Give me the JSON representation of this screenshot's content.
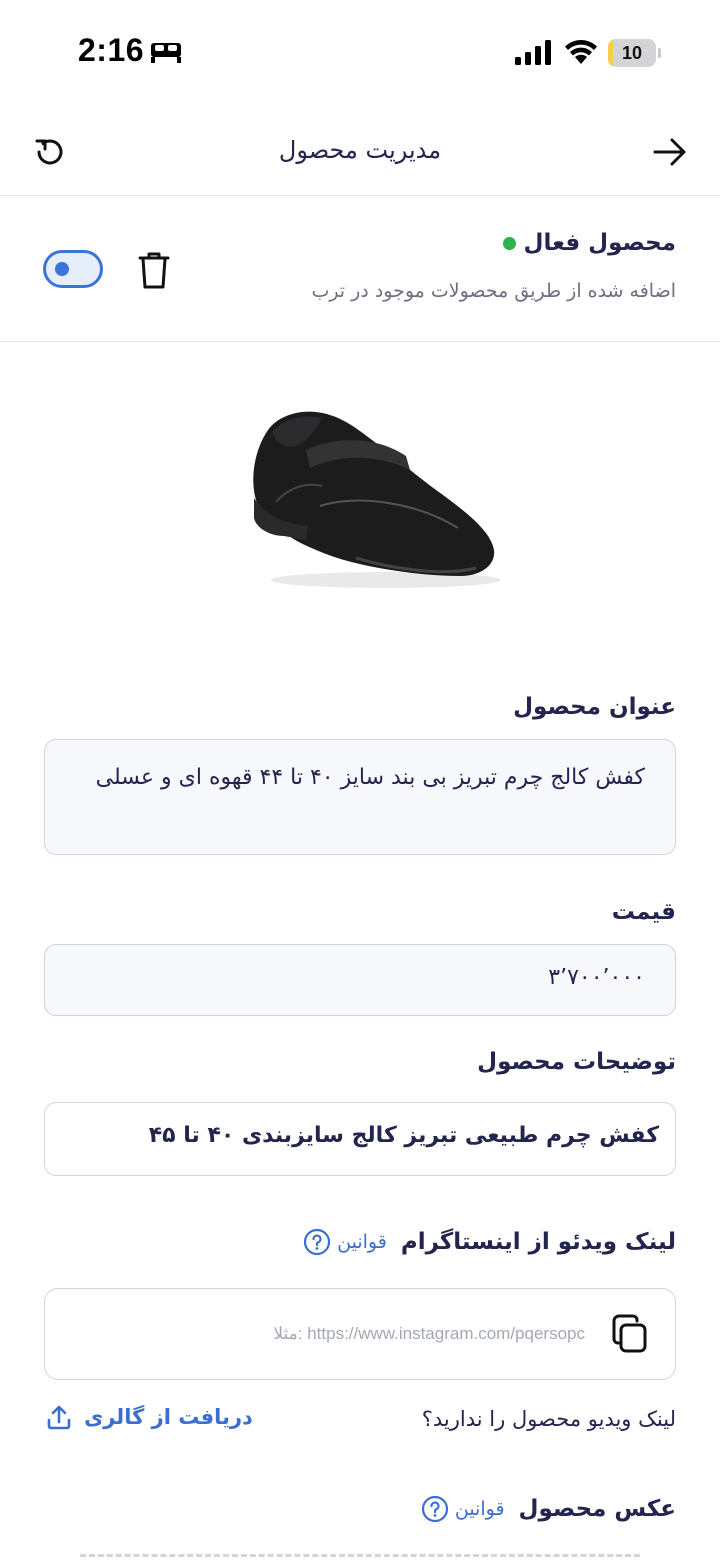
{
  "status_bar": {
    "time": "2:16",
    "battery": "10",
    "battery_level": 0.1
  },
  "header": {
    "title": "مدیریت محصول"
  },
  "product_status": {
    "title": "محصول فعال",
    "subtitle": "اضافه شده از طریق محصولات موجود در ترب",
    "active": true,
    "status_color": "#2fb24c"
  },
  "form": {
    "title_label": "عنوان محصول",
    "title_value": "کفش کالج چرم تبریز بی بند سایز ۴۰ تا ۴۴ قهوه ای و عسلی",
    "price_label": "قیمت",
    "price_value": "۳٬۷۰۰٬۰۰۰",
    "description_label": "توضیحات محصول",
    "description_value": "کفش چرم طبیعی تبریز کالج سایزبندی ۴۰ تا ۴۵",
    "instagram_label": "لینک ویدئو از اینستاگرام",
    "rules_label": "قوانین",
    "instagram_placeholder": "مثلا: https://www.instagram.com/pqersopc",
    "instagram_value": "",
    "no_link_text": "لینک ویدیو محصول را ندارید؟",
    "gallery_button": "دریافت از گالری",
    "photo_label": "عکس محصول",
    "photo_rules_label": "قوانین"
  },
  "colors": {
    "accent": "#3a6fd0",
    "text": "#23254e",
    "muted": "#6c7080"
  }
}
